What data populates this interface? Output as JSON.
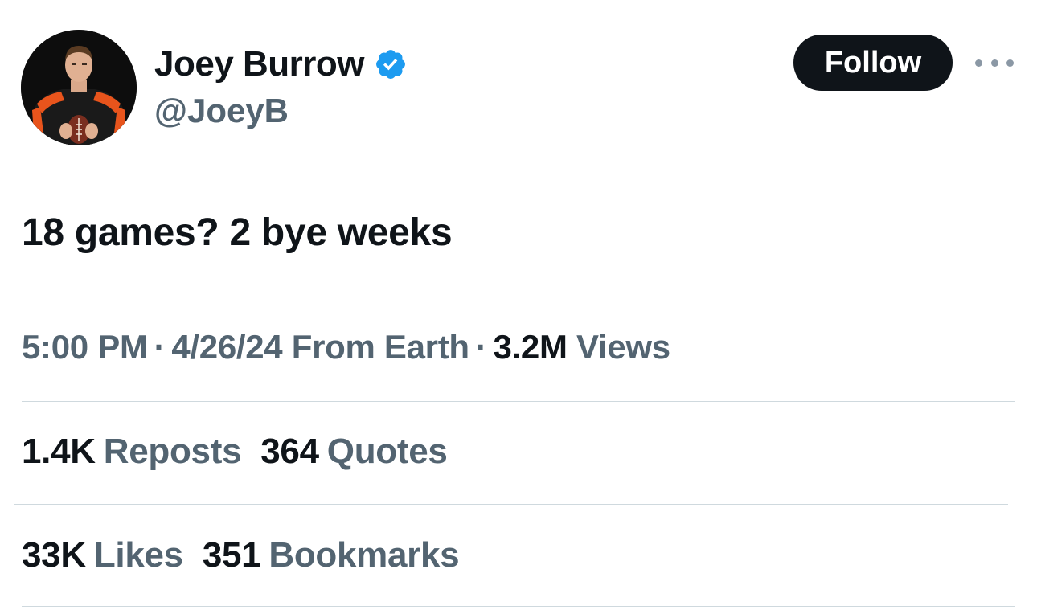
{
  "author": {
    "display_name": "Joey Burrow",
    "handle": "@JoeyB",
    "verified_icon": "verified-badge-icon",
    "verified_color": "#1d9bf0"
  },
  "header": {
    "follow_label": "Follow",
    "more_icon": "more-horizontal-icon"
  },
  "tweet": {
    "text": "18 games? 2 bye weeks"
  },
  "meta": {
    "time": "5:00 PM",
    "separator": "·",
    "date": "4/26/24",
    "source": "From Earth",
    "views_count": "3.2M",
    "views_label": "Views"
  },
  "stats": {
    "reposts_count": "1.4K",
    "reposts_label": "Reposts",
    "quotes_count": "364",
    "quotes_label": "Quotes",
    "likes_count": "33K",
    "likes_label": "Likes",
    "bookmarks_count": "351",
    "bookmarks_label": "Bookmarks"
  },
  "colors": {
    "text_primary": "#0f1419",
    "text_secondary": "#536471",
    "divider": "#cfd9de",
    "follow_bg": "#0f1419"
  }
}
